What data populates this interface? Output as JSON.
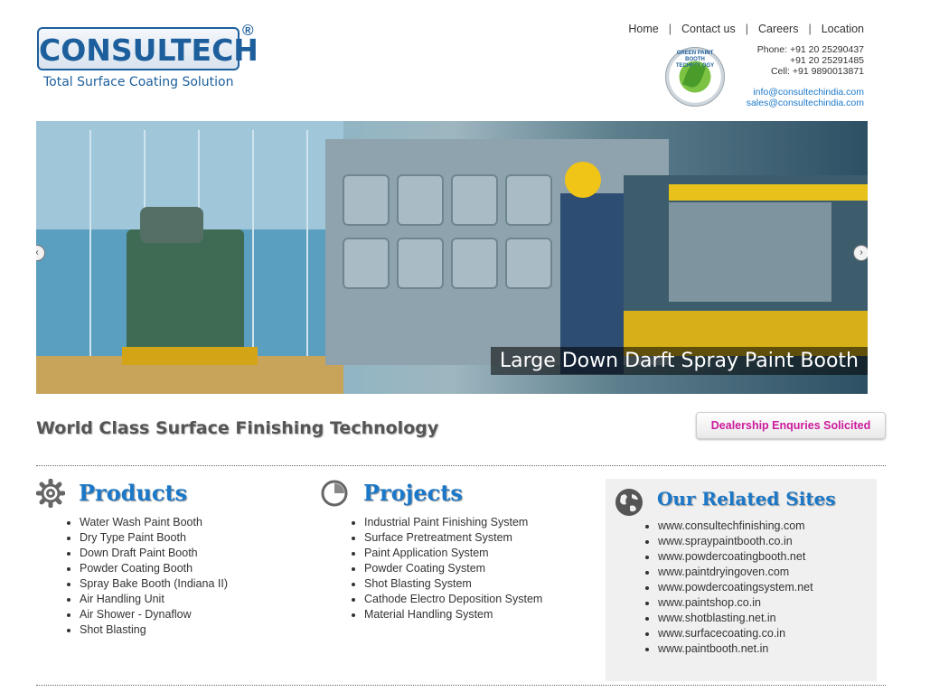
{
  "logo": {
    "name": "CONSULTECH",
    "registered": "®",
    "tagline": "Total Surface Coating Solution"
  },
  "nav": {
    "items": [
      "Home",
      "Contact us",
      "Careers",
      "Location"
    ],
    "separator": "|"
  },
  "badge": {
    "text": "GREEN PAINT BOOTH TECHNOLOGY",
    "icon": "leaf-icon"
  },
  "contact": {
    "phone_label": "Phone:",
    "phone1": "+91 20 25290437",
    "phone2": "+91 20 25291485",
    "cell_label": "Cell:",
    "cell": "+91 9890013871",
    "email1": "info@consultechindia.com",
    "email2": "sales@consultechindia.com"
  },
  "banner": {
    "caption": "Large Down Darft Spray Paint Booth",
    "prev_icon": "chevron-left-icon",
    "next_icon": "chevron-right-icon"
  },
  "tagline": "World Class Surface Finishing Technology",
  "dealer_button": "Dealership Enquries Solicited",
  "products": {
    "title": "Products",
    "icon": "gear-icon",
    "items": [
      "Water Wash Paint Booth",
      "Dry Type Paint Booth",
      "Down Draft Paint Booth",
      "Powder Coating Booth",
      "Spray Bake Booth (Indiana II)",
      "Air Handling Unit",
      "Air Shower - Dynaflow",
      "Shot Blasting"
    ]
  },
  "projects": {
    "title": "Projects",
    "icon": "clock-icon",
    "items": [
      "Industrial Paint Finishing System",
      "Surface Pretreatment System",
      "Paint Application System",
      "Powder Coating System",
      "Shot Blasting System",
      "Cathode Electro Deposition System",
      "Material Handling System"
    ]
  },
  "related": {
    "title": "Our Related Sites",
    "icon": "globe-icon",
    "items": [
      "www.consultechfinishing.com",
      "www.spraypaintbooth.co.in",
      "www.powdercoatingbooth.net",
      "www.paintdryingoven.com",
      "www.powdercoatingsystem.net",
      "www.paintshop.co.in",
      "www.shotblasting.net.in",
      "www.surfacecoating.co.in",
      "www.paintbooth.net.in"
    ]
  },
  "colors": {
    "brand_blue": "#1d5f9c",
    "link_blue": "#1b78c8",
    "dealer_pink": "#cc1b9c"
  }
}
